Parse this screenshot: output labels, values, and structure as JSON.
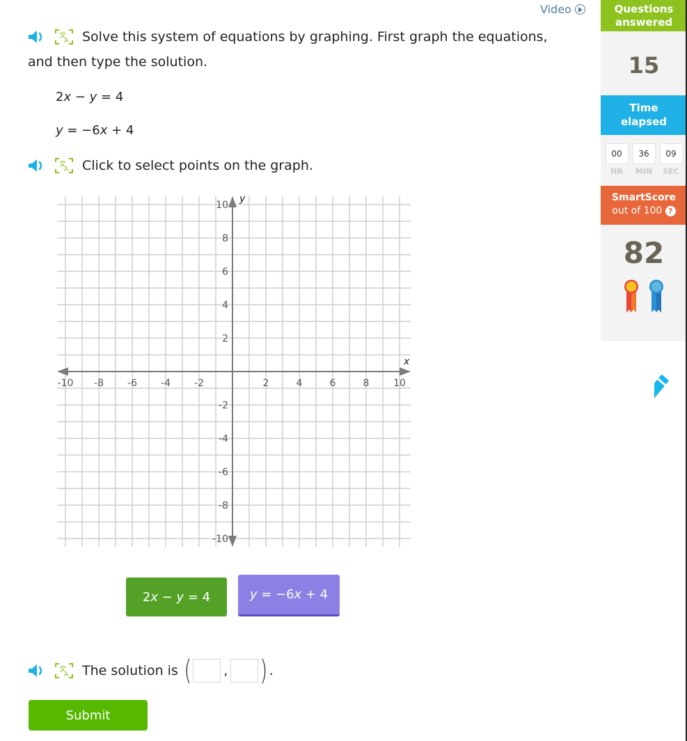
{
  "header": {
    "video_label": "Video"
  },
  "question": {
    "instruction": "Solve this system of equations by graphing. First graph the equations,",
    "instruction_line2": "and then type the solution.",
    "equations": [
      {
        "parts": [
          "2",
          "x",
          " − ",
          "y",
          " = 4"
        ]
      },
      {
        "parts": [
          "",
          "y",
          " = −6",
          "x",
          " + 4"
        ]
      }
    ],
    "graph_instruction": "Click to select points on the graph.",
    "solution_prefix": "The solution is",
    "solution_x": "",
    "solution_y": "",
    "submit_label": "Submit"
  },
  "equation_buttons": [
    {
      "label_parts": [
        "2",
        "x",
        " − ",
        "y",
        " = 4"
      ],
      "color": "#54a127",
      "selected": false
    },
    {
      "label_parts": [
        "",
        "y",
        " = −6",
        "x",
        " + 4"
      ],
      "color": "#8b80e3",
      "selected": true
    }
  ],
  "sidebar": {
    "questions_label_1": "Questions",
    "questions_label_2": "answered",
    "questions_count": "15",
    "time_label_1": "Time",
    "time_label_2": "elapsed",
    "time": {
      "hr": "00",
      "min": "36",
      "sec": "09"
    },
    "time_units": {
      "hr": "HR",
      "min": "MIN",
      "sec": "SEC"
    },
    "score_label": "SmartScore",
    "score_sub": "out of 100",
    "score_help": "?",
    "score": "82",
    "awards": [
      "gold-ribbon",
      "blue-ribbon"
    ]
  },
  "colors": {
    "questions_header": "#8dc21f",
    "time_header": "#1fb1e6",
    "score_header": "#e8673a",
    "submit": "#56b800",
    "accent_blue": "#1fb1e6",
    "translate_green": "#8dc21f"
  },
  "chart_data": {
    "type": "line",
    "title": "",
    "xlabel": "x",
    "ylabel": "y",
    "xlim": [
      -10,
      10
    ],
    "ylim": [
      -10,
      10
    ],
    "grid": true,
    "grid_step": 1,
    "x_ticks": [
      -10,
      -8,
      -6,
      -4,
      -2,
      2,
      4,
      6,
      8,
      10
    ],
    "y_ticks": [
      10,
      8,
      6,
      4,
      2,
      -2,
      -4,
      -6,
      -8,
      -10
    ],
    "series": []
  }
}
